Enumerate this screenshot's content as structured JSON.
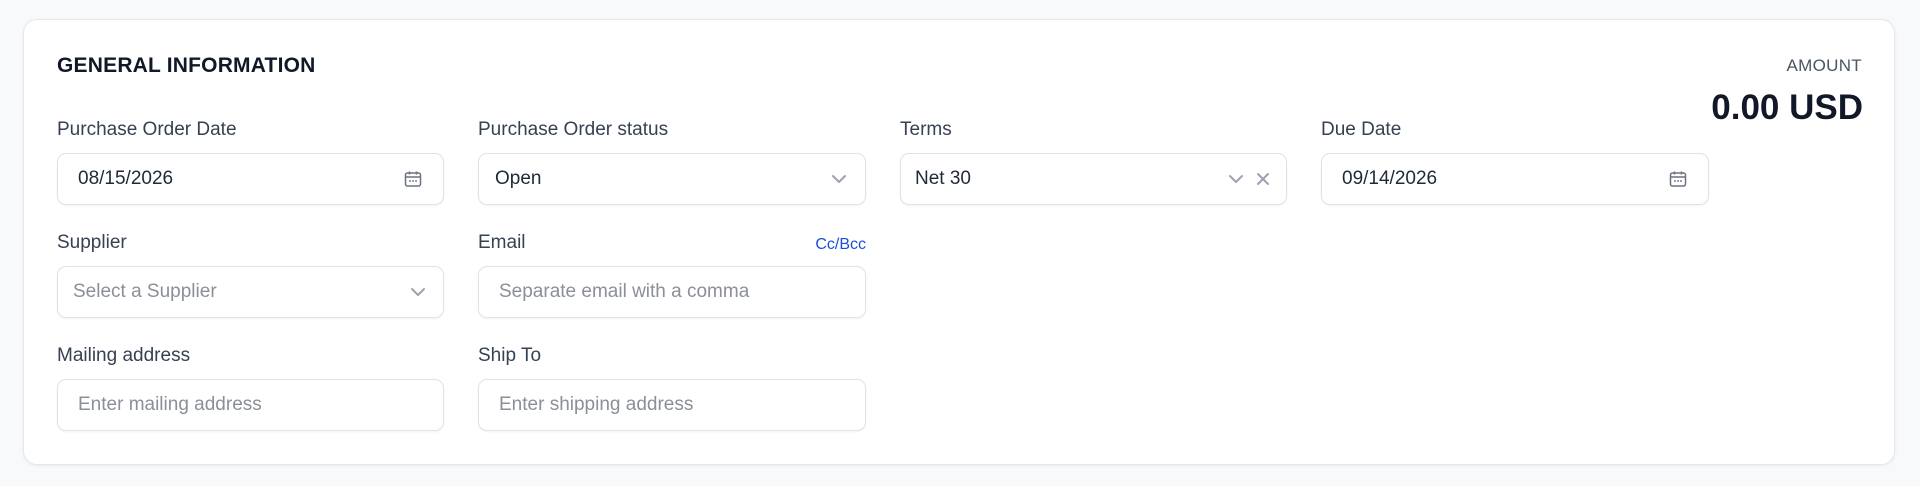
{
  "section": {
    "title": "GENERAL INFORMATION",
    "amount_label": "AMOUNT",
    "amount_value": "0.00 USD"
  },
  "fields": {
    "po_date": {
      "label": "Purchase Order Date",
      "value": "08/15/2026",
      "icon": "calendar-icon"
    },
    "po_status": {
      "label": "Purchase Order status",
      "value": "Open",
      "icon": "chevron-down-icon"
    },
    "terms": {
      "label": "Terms",
      "value": "Net 30",
      "icons": [
        "chevron-down-icon",
        "close-icon"
      ]
    },
    "due_date": {
      "label": "Due Date",
      "value": "09/14/2026",
      "icon": "calendar-icon"
    },
    "supplier": {
      "label": "Supplier",
      "placeholder": "Select a Supplier",
      "icon": "chevron-down-icon"
    },
    "email": {
      "label": "Email",
      "cc_bcc_link": "Cc/Bcc",
      "placeholder": "Separate email with a comma"
    },
    "mailing_address": {
      "label": "Mailing address",
      "placeholder": "Enter mailing address"
    },
    "ship_to": {
      "label": "Ship To",
      "placeholder": "Enter shipping address"
    }
  },
  "colors": {
    "accent_link": "#1d4ed8",
    "border": "#dfe3e8",
    "placeholder": "#8a8f98",
    "background": "#f8f9fb"
  }
}
